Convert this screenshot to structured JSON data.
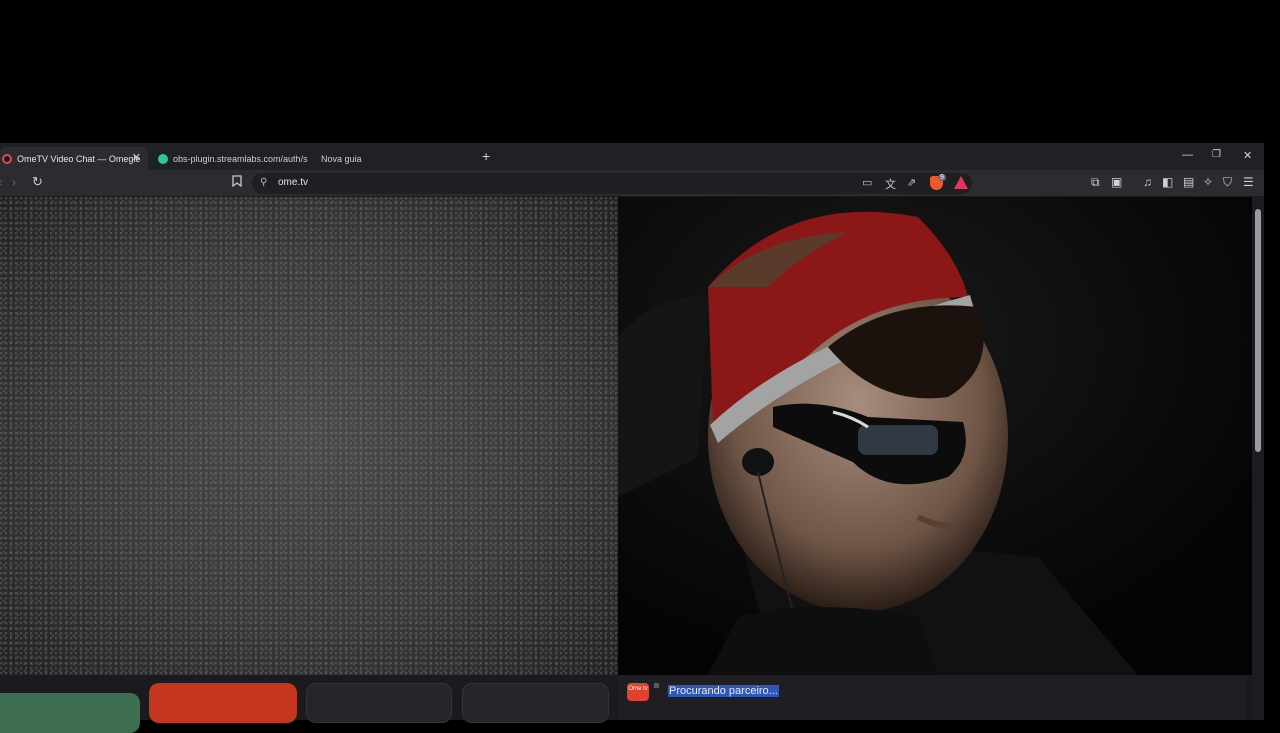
{
  "browser": {
    "tabs": [
      {
        "label": "OmeTV Video Chat — Omegle",
        "active": true
      },
      {
        "label": "obs-plugin.streamlabs.com/auth/suc",
        "active": false
      },
      {
        "label": "Nova guia",
        "active": false
      }
    ],
    "new_tab_label": "+",
    "window_controls": {
      "minimize": "—",
      "maximize": "❐",
      "close": "✕"
    },
    "address": {
      "url": "ome.tv"
    },
    "shield_badge": "9",
    "icons": {
      "back": "chevron-left-icon",
      "forward": "chevron-right-icon",
      "reload": "reload-icon",
      "bookmark": "bookmark-icon",
      "site_settings": "site-settings-icon",
      "cast": "cast-icon",
      "translate": "translate-icon",
      "share": "share-icon",
      "brave_shield": "brave-shield-icon",
      "rewards": "rewards-icon",
      "extensions": "extensions-icon",
      "tab_search": "tab-search-icon",
      "media": "music-icon",
      "sidebar": "sidebar-icon",
      "wallet": "wallet-icon",
      "leo": "leo-icon",
      "vpn": "vpn-icon",
      "menu": "menu-icon"
    }
  },
  "page": {
    "chat_status": "Procurando parceiro...",
    "logo_text": "Ome tv"
  },
  "colors": {
    "start_button": "#3f6f53",
    "stop_button": "#c5361f",
    "brave_shield": "#f1582a",
    "selection": "#2f57b8"
  }
}
